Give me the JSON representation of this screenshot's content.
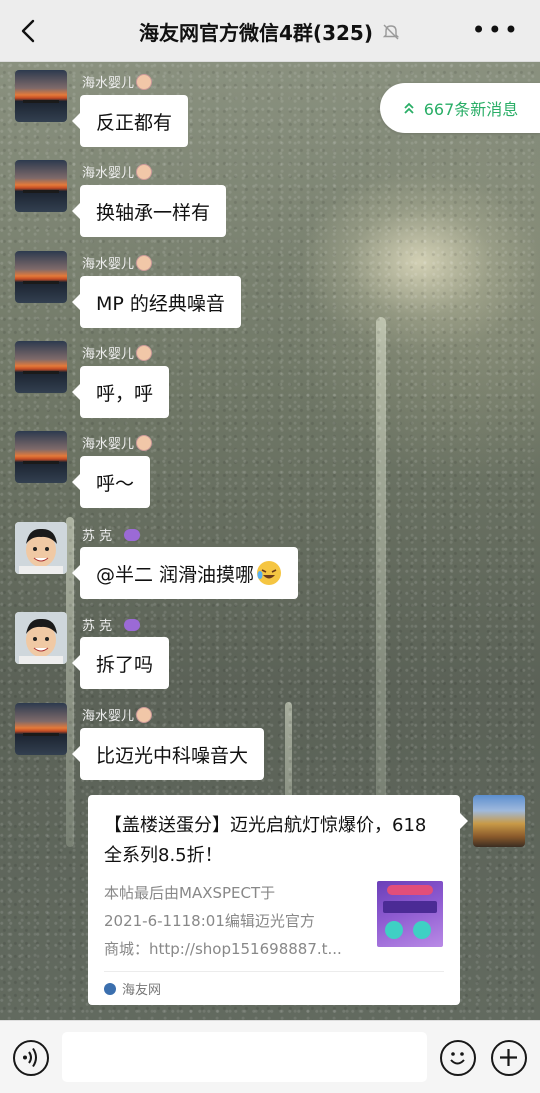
{
  "header": {
    "title": "海友网官方微信4群(325)",
    "more_label": "•••"
  },
  "new_messages": {
    "label": "667条新消息"
  },
  "messages": [
    {
      "sender": "海水婴儿",
      "text": "反正都有",
      "avatar": "sunset"
    },
    {
      "sender": "海水婴儿",
      "text": "换轴承一样有",
      "avatar": "sunset"
    },
    {
      "sender": "海水婴儿",
      "text": "MP 的经典噪音",
      "avatar": "sunset"
    },
    {
      "sender": "海水婴儿",
      "text": "呼，呼",
      "avatar": "sunset"
    },
    {
      "sender": "海水婴儿",
      "text": "呼～",
      "avatar": "sunset"
    },
    {
      "sender": "苏 克",
      "text": "@半二  润滑油摸哪",
      "avatar": "boy"
    },
    {
      "sender": "苏 克",
      "text": "拆了吗",
      "avatar": "boy"
    },
    {
      "sender": "海水婴儿",
      "text": "比迈光中科噪音大",
      "avatar": "sunset"
    }
  ],
  "link_card": {
    "title": "【盖楼送蛋分】迈光启航灯惊爆价，618全系列8.5折！",
    "desc_lines": [
      "本帖最后由MAXSPECT于",
      "2021-6-1118:01编辑迈光官方",
      "商城：http://shop151698887.t..."
    ],
    "source": "海友网"
  },
  "colors": {
    "accent_green": "#2aae67",
    "header_bg": "#ededed",
    "bubble_bg": "#ffffff"
  }
}
